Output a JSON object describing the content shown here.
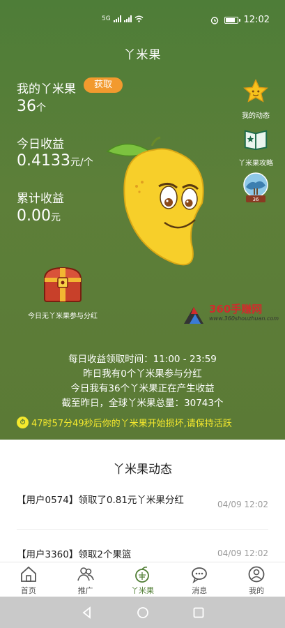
{
  "status": {
    "time": "12:02",
    "signal_label": "5G"
  },
  "app_title": "丫米果",
  "stats": {
    "my_label": "我的丫米果",
    "get_button": "获取",
    "my_count": "36",
    "my_unit": "个",
    "today_label": "今日收益",
    "today_value": "0.4133",
    "today_unit": "元/个",
    "total_label": "累计收益",
    "total_value": "0.00",
    "total_unit": "元"
  },
  "side_menu": [
    {
      "label": "我的动态",
      "icon": "star-icon"
    },
    {
      "label": "丫米果攻略",
      "icon": "book-icon"
    },
    {
      "label": "36",
      "icon": "tree-badge-icon"
    }
  ],
  "chest_label": "今日无丫米果参与分红",
  "watermark": {
    "brand": "360手赚网",
    "url": "www.360shouzhuan.com"
  },
  "info_lines": [
    "每日收益领取时间：11:00 - 23:59",
    "昨日我有0个丫米果参与分红",
    "今日我有36个丫米果正在产生收益",
    "截至昨日，全球丫米果总量：30743个"
  ],
  "warning": "47时57分49秒后你的丫米果开始损坏,请保持活跃",
  "feed": {
    "title": "丫米果动态",
    "items": [
      {
        "text": "【用户0574】领取了0.81元丫米果分红",
        "time": "04/09 12:02"
      },
      {
        "text": "【用户3360】领取2个果篮",
        "time": "04/09 12:02"
      }
    ]
  },
  "tabs": [
    {
      "label": "首页",
      "icon": "home-icon"
    },
    {
      "label": "推广",
      "icon": "people-icon"
    },
    {
      "label": "丫米果",
      "icon": "fruit-icon",
      "active": true
    },
    {
      "label": "消息",
      "icon": "message-icon"
    },
    {
      "label": "我的",
      "icon": "profile-icon"
    }
  ],
  "colors": {
    "hero": "#5a7d38",
    "accent_orange": "#f29a2e",
    "warning_yellow": "#f5e92d",
    "active_tab": "#4f7d33"
  }
}
